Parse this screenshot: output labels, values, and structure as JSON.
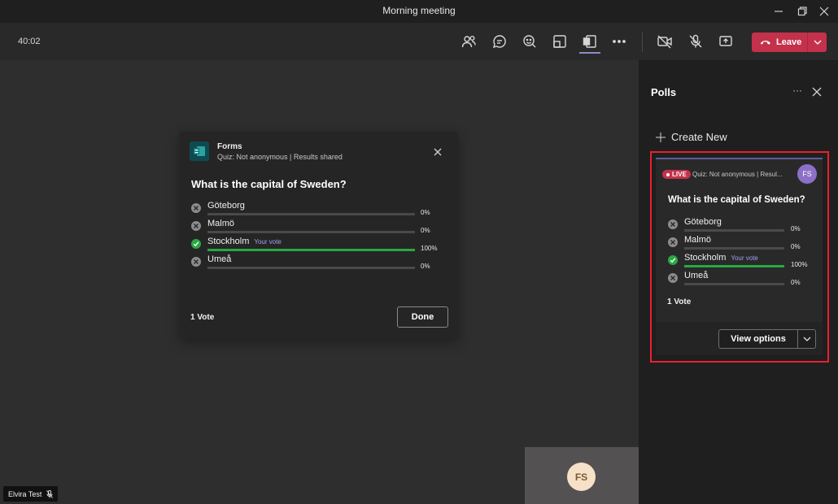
{
  "window": {
    "title": "Morning meeting"
  },
  "toolbar": {
    "timer": "40:02",
    "leave_label": "Leave",
    "icons": [
      "people-icon",
      "chat-icon",
      "reactions-icon",
      "rooms-icon",
      "apps-icon",
      "more-icon",
      "camera-off-icon",
      "mic-off-icon",
      "share-icon"
    ]
  },
  "dialog": {
    "app_name": "Forms",
    "subtitle": "Quiz: Not anonymous | Results shared",
    "question": "What is the capital of Sweden?",
    "options": [
      {
        "label": "Göteborg",
        "pct_text": "0%",
        "pct": 0,
        "correct": false,
        "your_vote": ""
      },
      {
        "label": "Malmö",
        "pct_text": "0%",
        "pct": 0,
        "correct": false,
        "your_vote": ""
      },
      {
        "label": "Stockholm",
        "pct_text": "100%",
        "pct": 100,
        "correct": true,
        "your_vote": "Your vote"
      },
      {
        "label": "Umeå",
        "pct_text": "0%",
        "pct": 0,
        "correct": false,
        "your_vote": ""
      }
    ],
    "votes": "1 Vote",
    "done_label": "Done"
  },
  "stage": {
    "self_avatar": "FS",
    "participant_name": "Elvira Test"
  },
  "panel": {
    "title": "Polls",
    "more_label": "···",
    "create_new": "Create New",
    "card": {
      "live_label": "LIVE",
      "subtitle": "Quiz: Not anonymous | Resul...",
      "avatar": "FS",
      "question": "What is the capital of Sweden?",
      "options": [
        {
          "label": "Göteborg",
          "pct_text": "0%",
          "pct": 0,
          "correct": false,
          "your_vote": ""
        },
        {
          "label": "Malmö",
          "pct_text": "0%",
          "pct": 0,
          "correct": false,
          "your_vote": ""
        },
        {
          "label": "Stockholm",
          "pct_text": "100%",
          "pct": 100,
          "correct": true,
          "your_vote": "Your vote"
        },
        {
          "label": "Umeå",
          "pct_text": "0%",
          "pct": 0,
          "correct": false,
          "your_vote": ""
        }
      ],
      "votes": "1 Vote",
      "view_options_label": "View options"
    }
  },
  "colors": {
    "accent": "#5c5e9c",
    "leave": "#c4314b",
    "correct": "#29a843",
    "highlight": "#e8212e"
  }
}
